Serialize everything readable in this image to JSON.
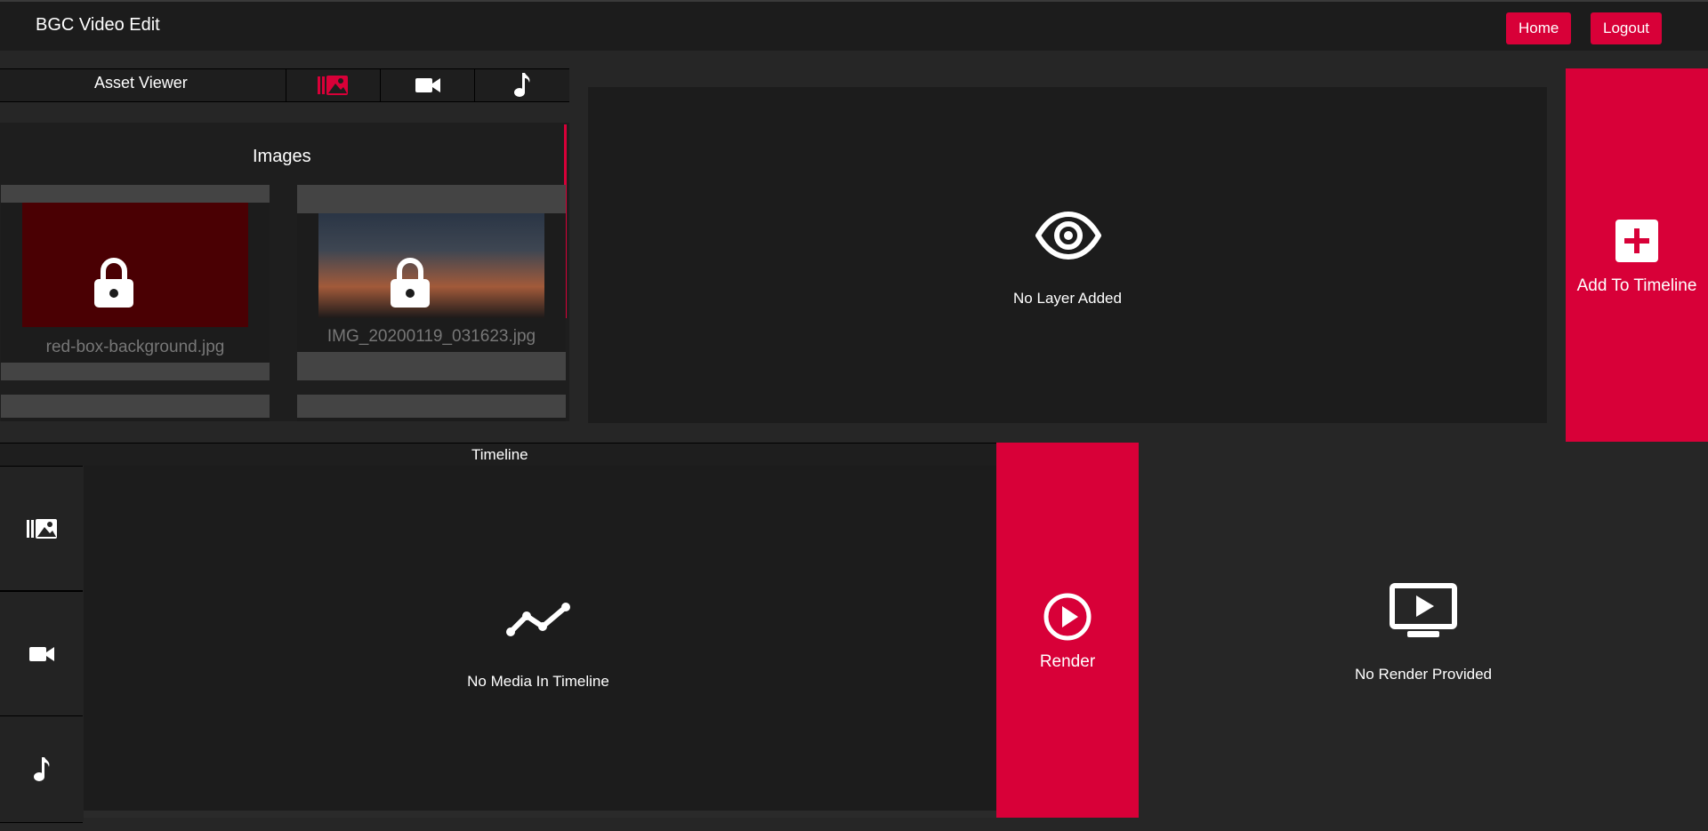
{
  "app": {
    "title": "BGC Video Edit"
  },
  "nav": {
    "home_label": "Home",
    "logout_label": "Logout"
  },
  "asset_viewer": {
    "title": "Asset Viewer",
    "tabs": [
      {
        "icon": "images-icon",
        "active": true
      },
      {
        "icon": "video-camera-icon",
        "active": false
      },
      {
        "icon": "music-note-icon",
        "active": false
      }
    ],
    "section_heading": "Images",
    "items": [
      {
        "name": "red-box-background.jpg",
        "locked": true
      },
      {
        "name": "IMG_20200119_031623.jpg",
        "locked": true
      }
    ]
  },
  "preview": {
    "empty_text": "No Layer Added"
  },
  "add_to_timeline": {
    "label": "Add To Timeline"
  },
  "timeline": {
    "title": "Timeline",
    "empty_text": "No Media In Timeline",
    "tracks": [
      {
        "icon": "images-icon"
      },
      {
        "icon": "video-camera-icon"
      },
      {
        "icon": "music-note-icon"
      }
    ]
  },
  "render": {
    "label": "Render",
    "empty_text": "No Render Provided"
  },
  "colors": {
    "accent": "#d80038",
    "background": "#262626",
    "panel": "#1c1c1c"
  }
}
